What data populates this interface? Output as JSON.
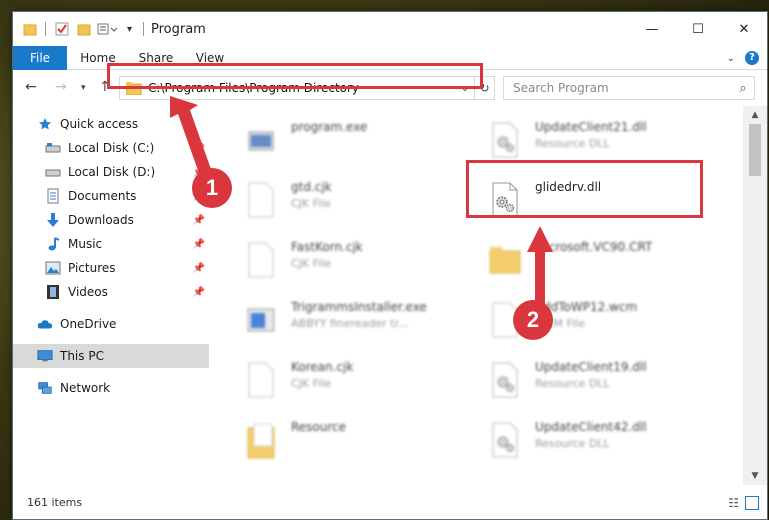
{
  "window": {
    "title": "Program",
    "controls": {
      "minimize": "—",
      "maximize": "☐",
      "close": "✕"
    }
  },
  "ribbon": {
    "tabs": [
      "File",
      "Home",
      "Share",
      "View"
    ]
  },
  "address_bar": {
    "path": "C:\\Program Files\\Program Directory"
  },
  "search": {
    "placeholder": "Search Program"
  },
  "sidebar": {
    "items": [
      {
        "label": "Quick access",
        "icon": "star-icon",
        "pinned": false
      },
      {
        "label": "Local Disk (C:)",
        "icon": "drive-icon",
        "pinned": true
      },
      {
        "label": "Local Disk (D:)",
        "icon": "drive-icon",
        "pinned": true
      },
      {
        "label": "Documents",
        "icon": "documents-icon",
        "pinned": true
      },
      {
        "label": "Downloads",
        "icon": "download-icon",
        "pinned": true
      },
      {
        "label": "Music",
        "icon": "music-icon",
        "pinned": true
      },
      {
        "label": "Pictures",
        "icon": "pictures-icon",
        "pinned": true
      },
      {
        "label": "Videos",
        "icon": "videos-icon",
        "pinned": true
      },
      {
        "label": "OneDrive",
        "icon": "cloud-icon",
        "pinned": false
      },
      {
        "label": "This PC",
        "icon": "computer-icon",
        "pinned": false,
        "selected": true
      },
      {
        "label": "Network",
        "icon": "network-icon",
        "pinned": false
      }
    ]
  },
  "files": [
    {
      "name": "program.exe",
      "type": "",
      "icon": "exe-icon"
    },
    {
      "name": "UpdateClient21.dll",
      "type": "Resource DLL",
      "icon": "dll-icon"
    },
    {
      "name": "gtd.cjk",
      "type": "CJK File",
      "icon": "file-icon"
    },
    {
      "name": "glidedrv.dll",
      "type": "",
      "icon": "dll-icon"
    },
    {
      "name": "FastKorn.cjk",
      "type": "CJK File",
      "icon": "file-icon"
    },
    {
      "name": "Microsoft.VC90.CRT",
      "type": "",
      "icon": "folder-icon"
    },
    {
      "name": "TrigrammsInstaller.exe",
      "type": "ABBYY finereader tr...",
      "icon": "installer-icon"
    },
    {
      "name": "AddToWP12.wcm",
      "type": "WCM File",
      "icon": "file-icon"
    },
    {
      "name": "Korean.cjk",
      "type": "CJK File",
      "icon": "file-icon"
    },
    {
      "name": "UpdateClient19.dll",
      "type": "Resource DLL",
      "icon": "dll-icon"
    },
    {
      "name": "Resource",
      "type": "",
      "icon": "folder-icon"
    },
    {
      "name": "UpdateClient42.dll",
      "type": "Resource DLL",
      "icon": "dll-icon"
    }
  ],
  "status": {
    "item_count": "161 items"
  },
  "annotations": {
    "step1": "1",
    "step2": "2"
  },
  "colors": {
    "accent": "#1979ca",
    "highlight": "#d9363e",
    "selected_bg": "#d9d9d9"
  }
}
